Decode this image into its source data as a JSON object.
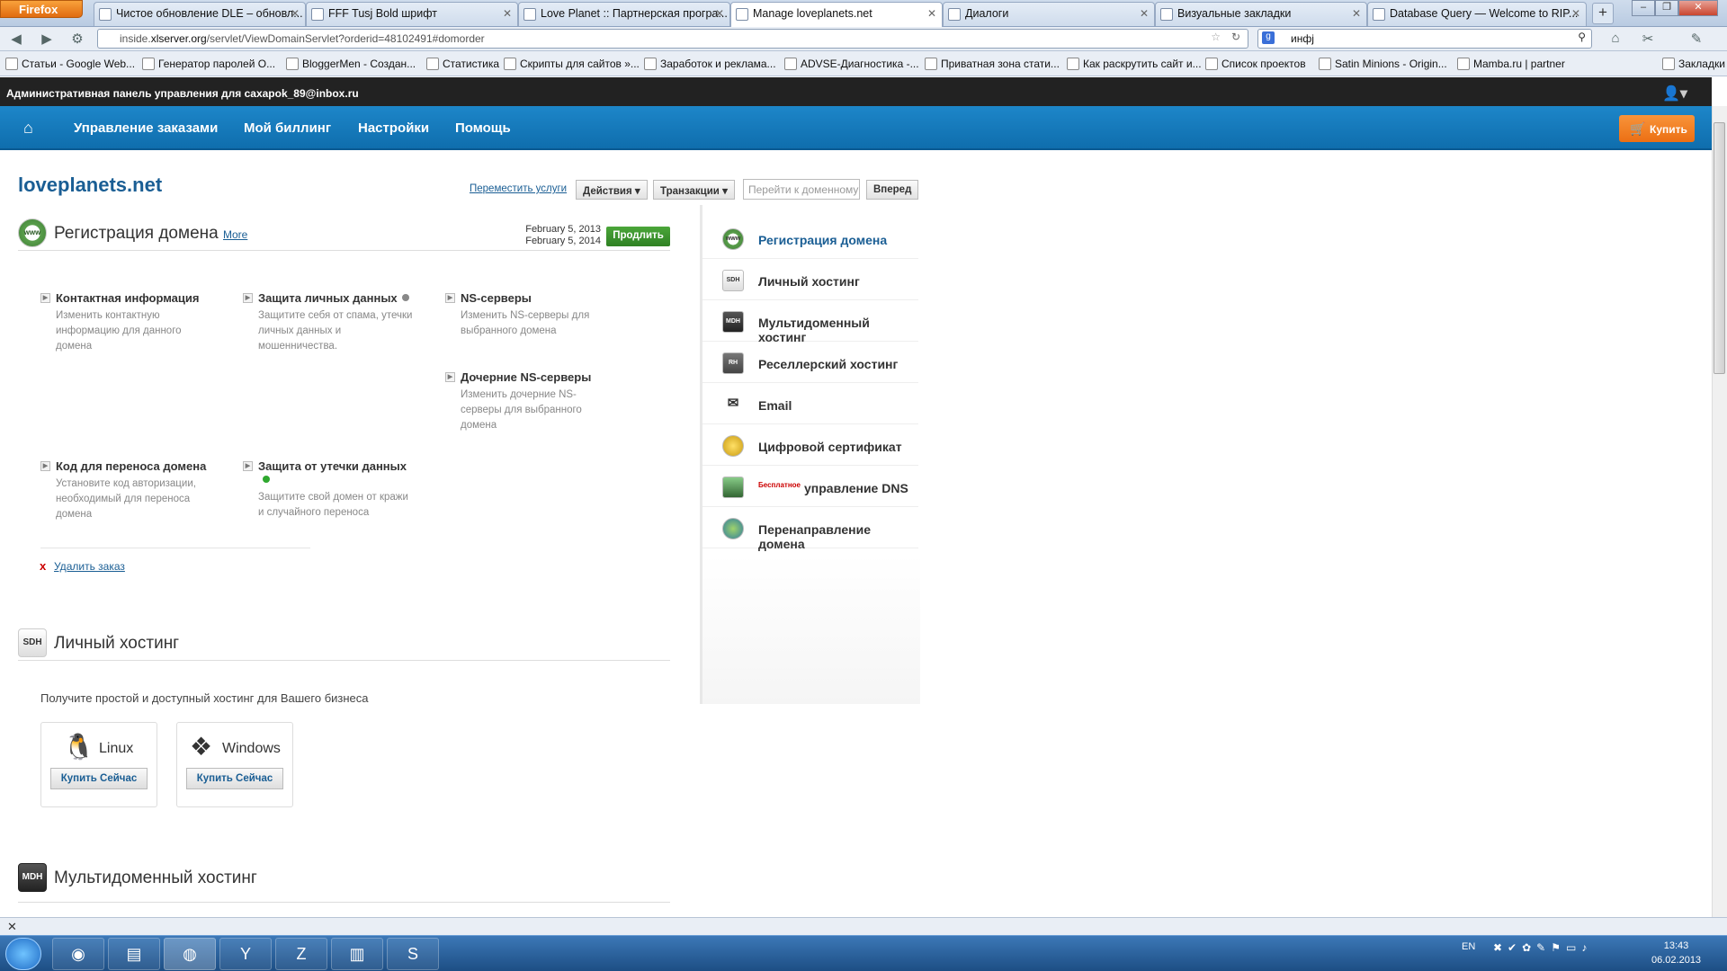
{
  "browser": {
    "menu_button": "Firefox",
    "tabs": [
      {
        "label": "Чистое обновление DLE – обновл..."
      },
      {
        "label": "FFF Tusj Bold шрифт"
      },
      {
        "label": "Love Planet :: Партнерская програ..."
      },
      {
        "label": "Manage loveplanets.net"
      },
      {
        "label": "Диалоги"
      },
      {
        "label": "Визуальные закладки"
      },
      {
        "label": "Database Query — Welcome to RIP..."
      }
    ],
    "url_prefix": "inside.",
    "url_host": "xlserver.org",
    "url_rest": "/servlet/ViewDomainServlet?orderid=48102491#domorder",
    "search_value": "инфj",
    "bookmarks": [
      "Статьи - Google Web...",
      "Генератор паролей О...",
      "BloggerMen - Создан...",
      "Статистика",
      "Скрипты для сайтов »...",
      "Заработок и реклама...",
      "ADVSE-Диагностика -...",
      "Приватная зона стати...",
      "Как раскрутить сайт и...",
      "Список проектов",
      "Satin Minions - Origin...",
      "Mamba.ru | partner"
    ],
    "bookmarks_menu": "Закладки"
  },
  "admin": {
    "title": "Административная панель управления для caxapok_89@inbox.ru"
  },
  "nav": {
    "items": [
      "Управление заказами",
      "Мой биллинг",
      "Настройки",
      "Помощь"
    ],
    "buy": "Купить"
  },
  "page": {
    "domain": "loveplanets.net",
    "move_services": "Переместить услуги",
    "actions": "Действия ▾",
    "transactions": "Транзакции ▾",
    "go_placeholder": "Перейти к доменному",
    "go_button": "Вперед"
  },
  "domain_reg": {
    "icon": "www",
    "title": "Регистрация домена",
    "more": "More",
    "date_from": "February 5, 2013",
    "date_to": "February 5, 2014",
    "renew": "Продлить",
    "items": [
      {
        "title": "Контактная информация",
        "desc": "Изменить контактную информацию для данного домена"
      },
      {
        "title": "Защита личных данных",
        "desc": "Защитите себя от спама, утечки личных данных и мошенничества.",
        "status_color": "#888888"
      },
      {
        "title": "NS-серверы",
        "desc": "Изменить NS-серверы для выбранного домена"
      },
      {
        "title": "Дочерние NS-серверы",
        "desc": "Изменить дочерние NS-серверы для выбранного домена"
      },
      {
        "title": "Код для переноса домена",
        "desc": "Установите код авторизации, необходимый для переноса домена"
      },
      {
        "title": "Защита от утечки данных",
        "desc": "Защитите свой домен от кражи и случайного переноса",
        "status_color": "#2fa82f"
      }
    ],
    "delete": "Удалить заказ"
  },
  "hosting": {
    "icon": "SDH",
    "title": "Личный хостинг",
    "subtitle": "Получите простой и доступный хостинг для Вашего бизнеса",
    "options": [
      {
        "label": "Linux",
        "button": "Купить Сейчас"
      },
      {
        "label": "Windows",
        "button": "Купить Сейчас"
      }
    ]
  },
  "multi": {
    "icon": "MDH",
    "title": "Мультидоменный хостинг"
  },
  "sidebar": {
    "items": [
      {
        "label": "Регистрация домена",
        "icon": "www"
      },
      {
        "label": "Личный хостинг",
        "icon": "SDH"
      },
      {
        "label": "Мультидоменный хостинг",
        "icon": "MDH"
      },
      {
        "label": "Реселлерский хостинг",
        "icon": "RH"
      },
      {
        "label": "Email",
        "icon": "email-icon"
      },
      {
        "label": "Цифровой сертификат",
        "icon": "certificate-icon"
      },
      {
        "label": "управление DNS",
        "icon": "dns-icon",
        "badge": "Бесплатное"
      },
      {
        "label": "Перенаправление домена",
        "icon": "forward-icon"
      }
    ]
  },
  "taskbar": {
    "lang": "EN",
    "time": "13:43",
    "date": "06.02.2013"
  },
  "colors": {
    "accent": "#1178bd",
    "buy": "#f1801f",
    "renew": "#3a8f2c",
    "link": "#1a5e94"
  }
}
